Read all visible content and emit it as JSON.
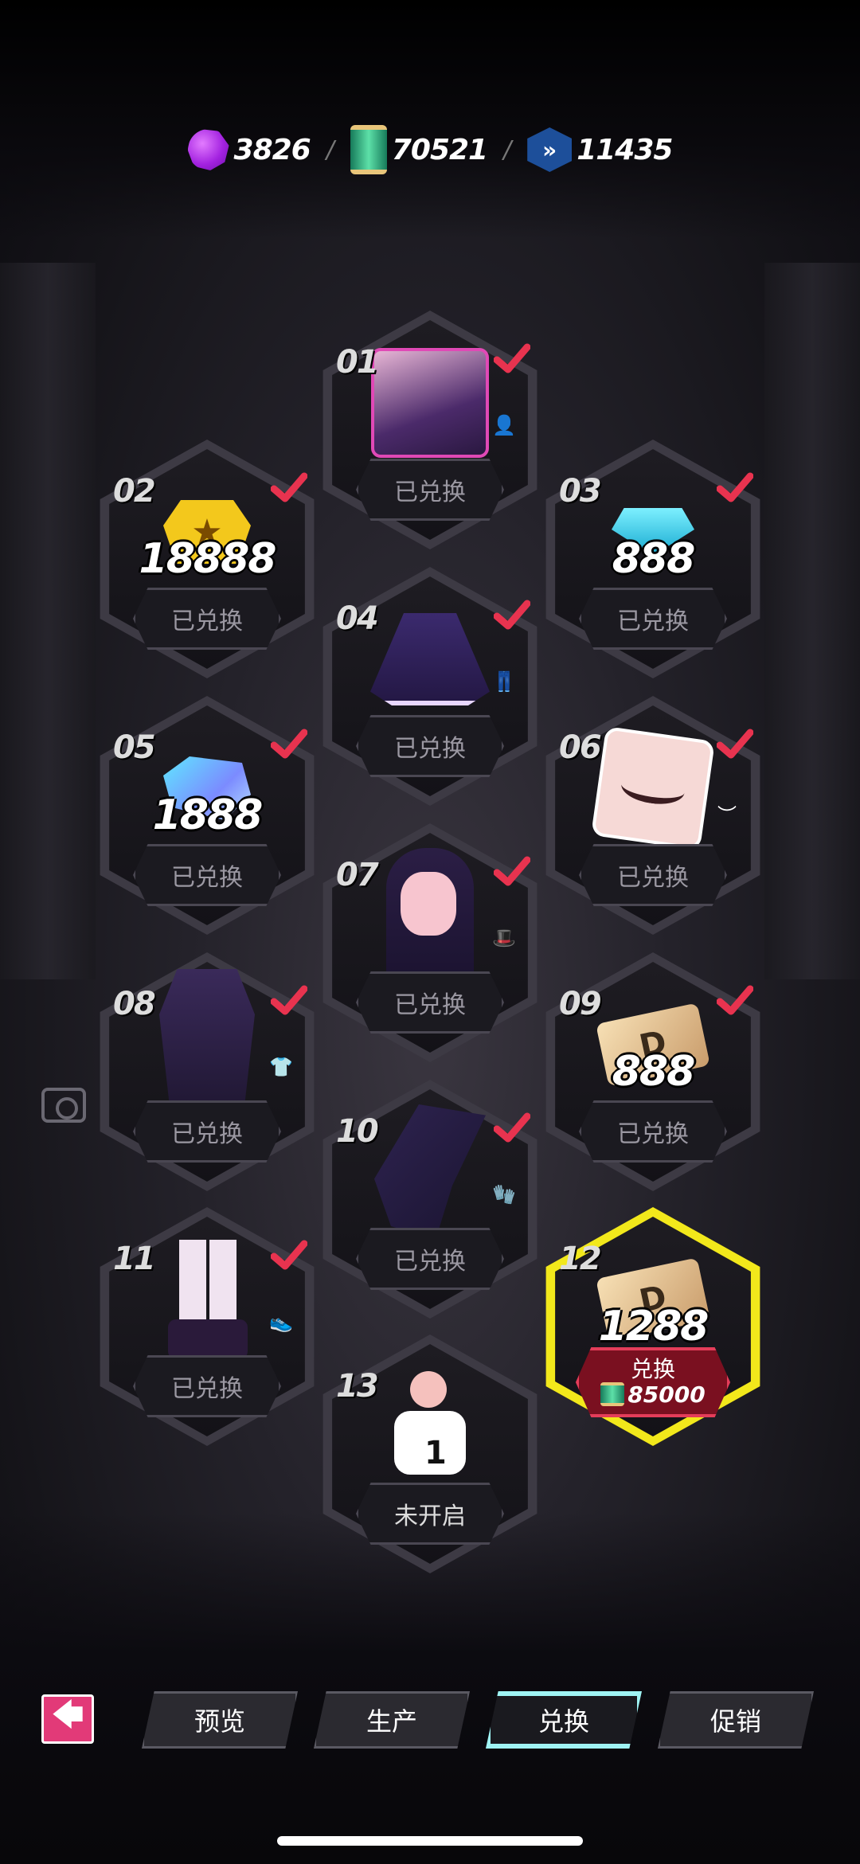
{
  "currencies": {
    "gems": "3826",
    "scrolls": "70521",
    "tokens": "11435"
  },
  "slots": [
    {
      "num": "01",
      "status": "已兑换",
      "art": "portrait",
      "type": "avatar"
    },
    {
      "num": "02",
      "status": "已兑换",
      "amount": "18888",
      "art": "gold-coin"
    },
    {
      "num": "03",
      "status": "已兑换",
      "amount": "888",
      "art": "blue-gem"
    },
    {
      "num": "04",
      "status": "已兑换",
      "art": "skirt",
      "type": "pants"
    },
    {
      "num": "05",
      "status": "已兑换",
      "amount": "1888",
      "art": "crystal"
    },
    {
      "num": "06",
      "status": "已兑换",
      "art": "eye-card",
      "type": "eyebrow"
    },
    {
      "num": "07",
      "status": "已兑换",
      "art": "wig",
      "type": "hat"
    },
    {
      "num": "08",
      "status": "已兑换",
      "art": "dress",
      "type": "shirt"
    },
    {
      "num": "09",
      "status": "已兑换",
      "amount": "888",
      "art": "ticket"
    },
    {
      "num": "10",
      "status": "已兑换",
      "art": "gloves",
      "type": "glove"
    },
    {
      "num": "11",
      "status": "已兑换",
      "art": "shoes",
      "type": "shoe"
    },
    {
      "num": "12",
      "amount": "1288",
      "art": "ticket",
      "redeem_label": "兑换",
      "cost": "85000"
    },
    {
      "num": "13",
      "status": "未开启",
      "art": "character",
      "badge": "1"
    }
  ],
  "nav": {
    "tabs": [
      "预览",
      "生产",
      "兑换",
      "促销"
    ],
    "selected": "兑换",
    "back_symbol": "🡄"
  },
  "colors": {
    "active_slot": "#f2e81b",
    "redeem_button": "#7a1020",
    "check": "#e8334f"
  }
}
